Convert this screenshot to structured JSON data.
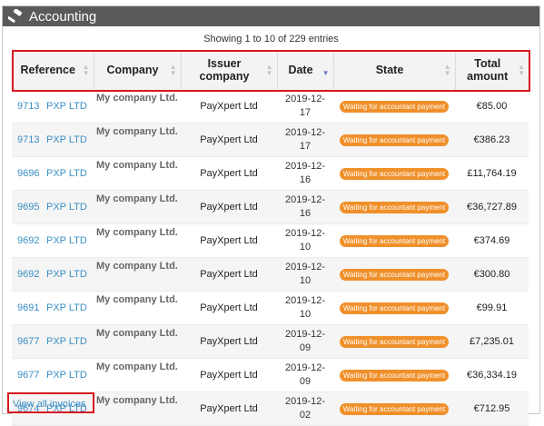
{
  "panel": {
    "title": "Accounting",
    "icon": "gavel-icon"
  },
  "showing_text": "Showing 1 to 10 of 229 entries",
  "columns": [
    "Reference",
    "Company",
    "Issuer company",
    "Date",
    "State",
    "Total amount"
  ],
  "sort_column": "Date",
  "rows": [
    {
      "ref": "9713",
      "ref_company": "PXP LTD",
      "company": "My company Ltd.",
      "issuer": "PayXpert Ltd",
      "date": "2019-12-17",
      "state": "Waiting for accountant payment",
      "amount": "€85.00"
    },
    {
      "ref": "9713",
      "ref_company": "PXP LTD",
      "company": "My company Ltd.",
      "issuer": "PayXpert Ltd",
      "date": "2019-12-17",
      "state": "Waiting for accountant payment",
      "amount": "€386.23"
    },
    {
      "ref": "9696",
      "ref_company": "PXP LTD",
      "company": "My company Ltd.",
      "issuer": "PayXpert Ltd",
      "date": "2019-12-16",
      "state": "Waiting for accountant payment",
      "amount": "£11,764.19"
    },
    {
      "ref": "9695",
      "ref_company": "PXP LTD",
      "company": "My company Ltd.",
      "issuer": "PayXpert Ltd",
      "date": "2019-12-16",
      "state": "Waiting for accountant payment",
      "amount": "€36,727.89"
    },
    {
      "ref": "9692",
      "ref_company": "PXP LTD",
      "company": "My company Ltd.",
      "issuer": "PayXpert Ltd",
      "date": "2019-12-10",
      "state": "Waiting for accountant payment",
      "amount": "€374.69"
    },
    {
      "ref": "9692",
      "ref_company": "PXP LTD",
      "company": "My company Ltd.",
      "issuer": "PayXpert Ltd",
      "date": "2019-12-10",
      "state": "Waiting for accountant payment",
      "amount": "€300.80"
    },
    {
      "ref": "9691",
      "ref_company": "PXP LTD",
      "company": "My company Ltd.",
      "issuer": "PayXpert Ltd",
      "date": "2019-12-10",
      "state": "Waiting for accountant payment",
      "amount": "€99.91"
    },
    {
      "ref": "9677",
      "ref_company": "PXP LTD",
      "company": "My company Ltd.",
      "issuer": "PayXpert Ltd",
      "date": "2019-12-09",
      "state": "Waiting for accountant payment",
      "amount": "£7,235.01"
    },
    {
      "ref": "9677",
      "ref_company": "PXP LTD",
      "company": "My company Ltd.",
      "issuer": "PayXpert Ltd",
      "date": "2019-12-09",
      "state": "Waiting for accountant payment",
      "amount": "€36,334.19"
    },
    {
      "ref": "9674",
      "ref_company": "PXP LTD",
      "company": "My company Ltd.",
      "issuer": "PayXpert Ltd",
      "date": "2019-12-02",
      "state": "Waiting for accountant payment",
      "amount": "€712.95"
    }
  ],
  "footer_link": "View all invoices",
  "colors": {
    "header_bg": "#5a5a5a",
    "badge": "#f0902a",
    "link": "#3a8fc4",
    "highlight": "#d71920"
  }
}
